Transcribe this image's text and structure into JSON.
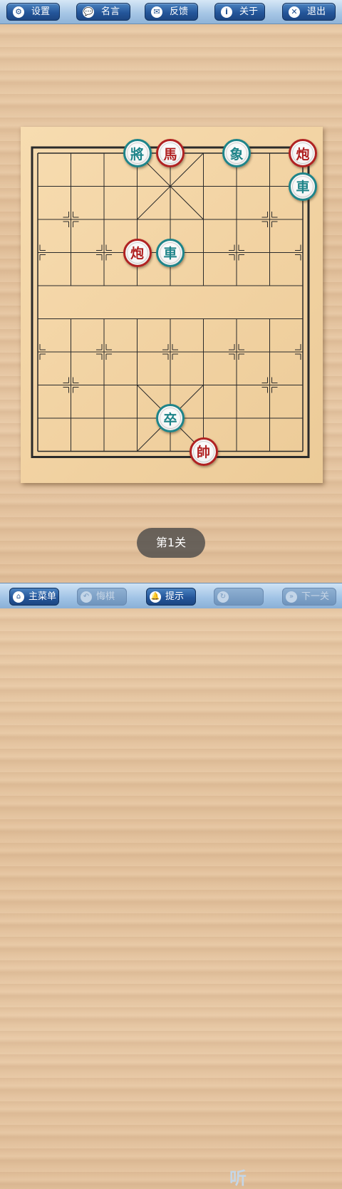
{
  "toolbar": {
    "settings_label": "设置",
    "quotes_label": "名言",
    "feedback_label": "反馈",
    "about_label": "关于",
    "exit_label": "退出"
  },
  "icons": {
    "settings": "gear-icon",
    "quotes": "speech-bubble-icon",
    "feedback": "envelope-icon",
    "about": "info-icon",
    "exit": "close-icon"
  },
  "board": {
    "files": 9,
    "ranks": 10,
    "line_color": "#2a2a2a",
    "board_color": "#f2d3a3",
    "pieces": [
      {
        "label": "將",
        "side": "black",
        "file": 3,
        "rank": 0
      },
      {
        "label": "馬",
        "side": "red",
        "file": 4,
        "rank": 0
      },
      {
        "label": "象",
        "side": "black",
        "file": 6,
        "rank": 0
      },
      {
        "label": "炮",
        "side": "red",
        "file": 8,
        "rank": 0
      },
      {
        "label": "車",
        "side": "black",
        "file": 8,
        "rank": 1
      },
      {
        "label": "炮",
        "side": "red",
        "file": 3,
        "rank": 3
      },
      {
        "label": "車",
        "side": "black",
        "file": 4,
        "rank": 3
      },
      {
        "label": "卒",
        "side": "black",
        "file": 4,
        "rank": 8
      },
      {
        "label": "帥",
        "side": "red",
        "file": 5,
        "rank": 9
      }
    ]
  },
  "level_label": "第1关",
  "bottom": {
    "main_menu_label": "主菜单",
    "undo_label": "悔棋",
    "hint_label": "提示",
    "restart_label": "",
    "next_label": "下一关"
  },
  "colors": {
    "red_piece": "#b02222",
    "black_piece": "#1e8489",
    "button_blue": "#24569a"
  }
}
